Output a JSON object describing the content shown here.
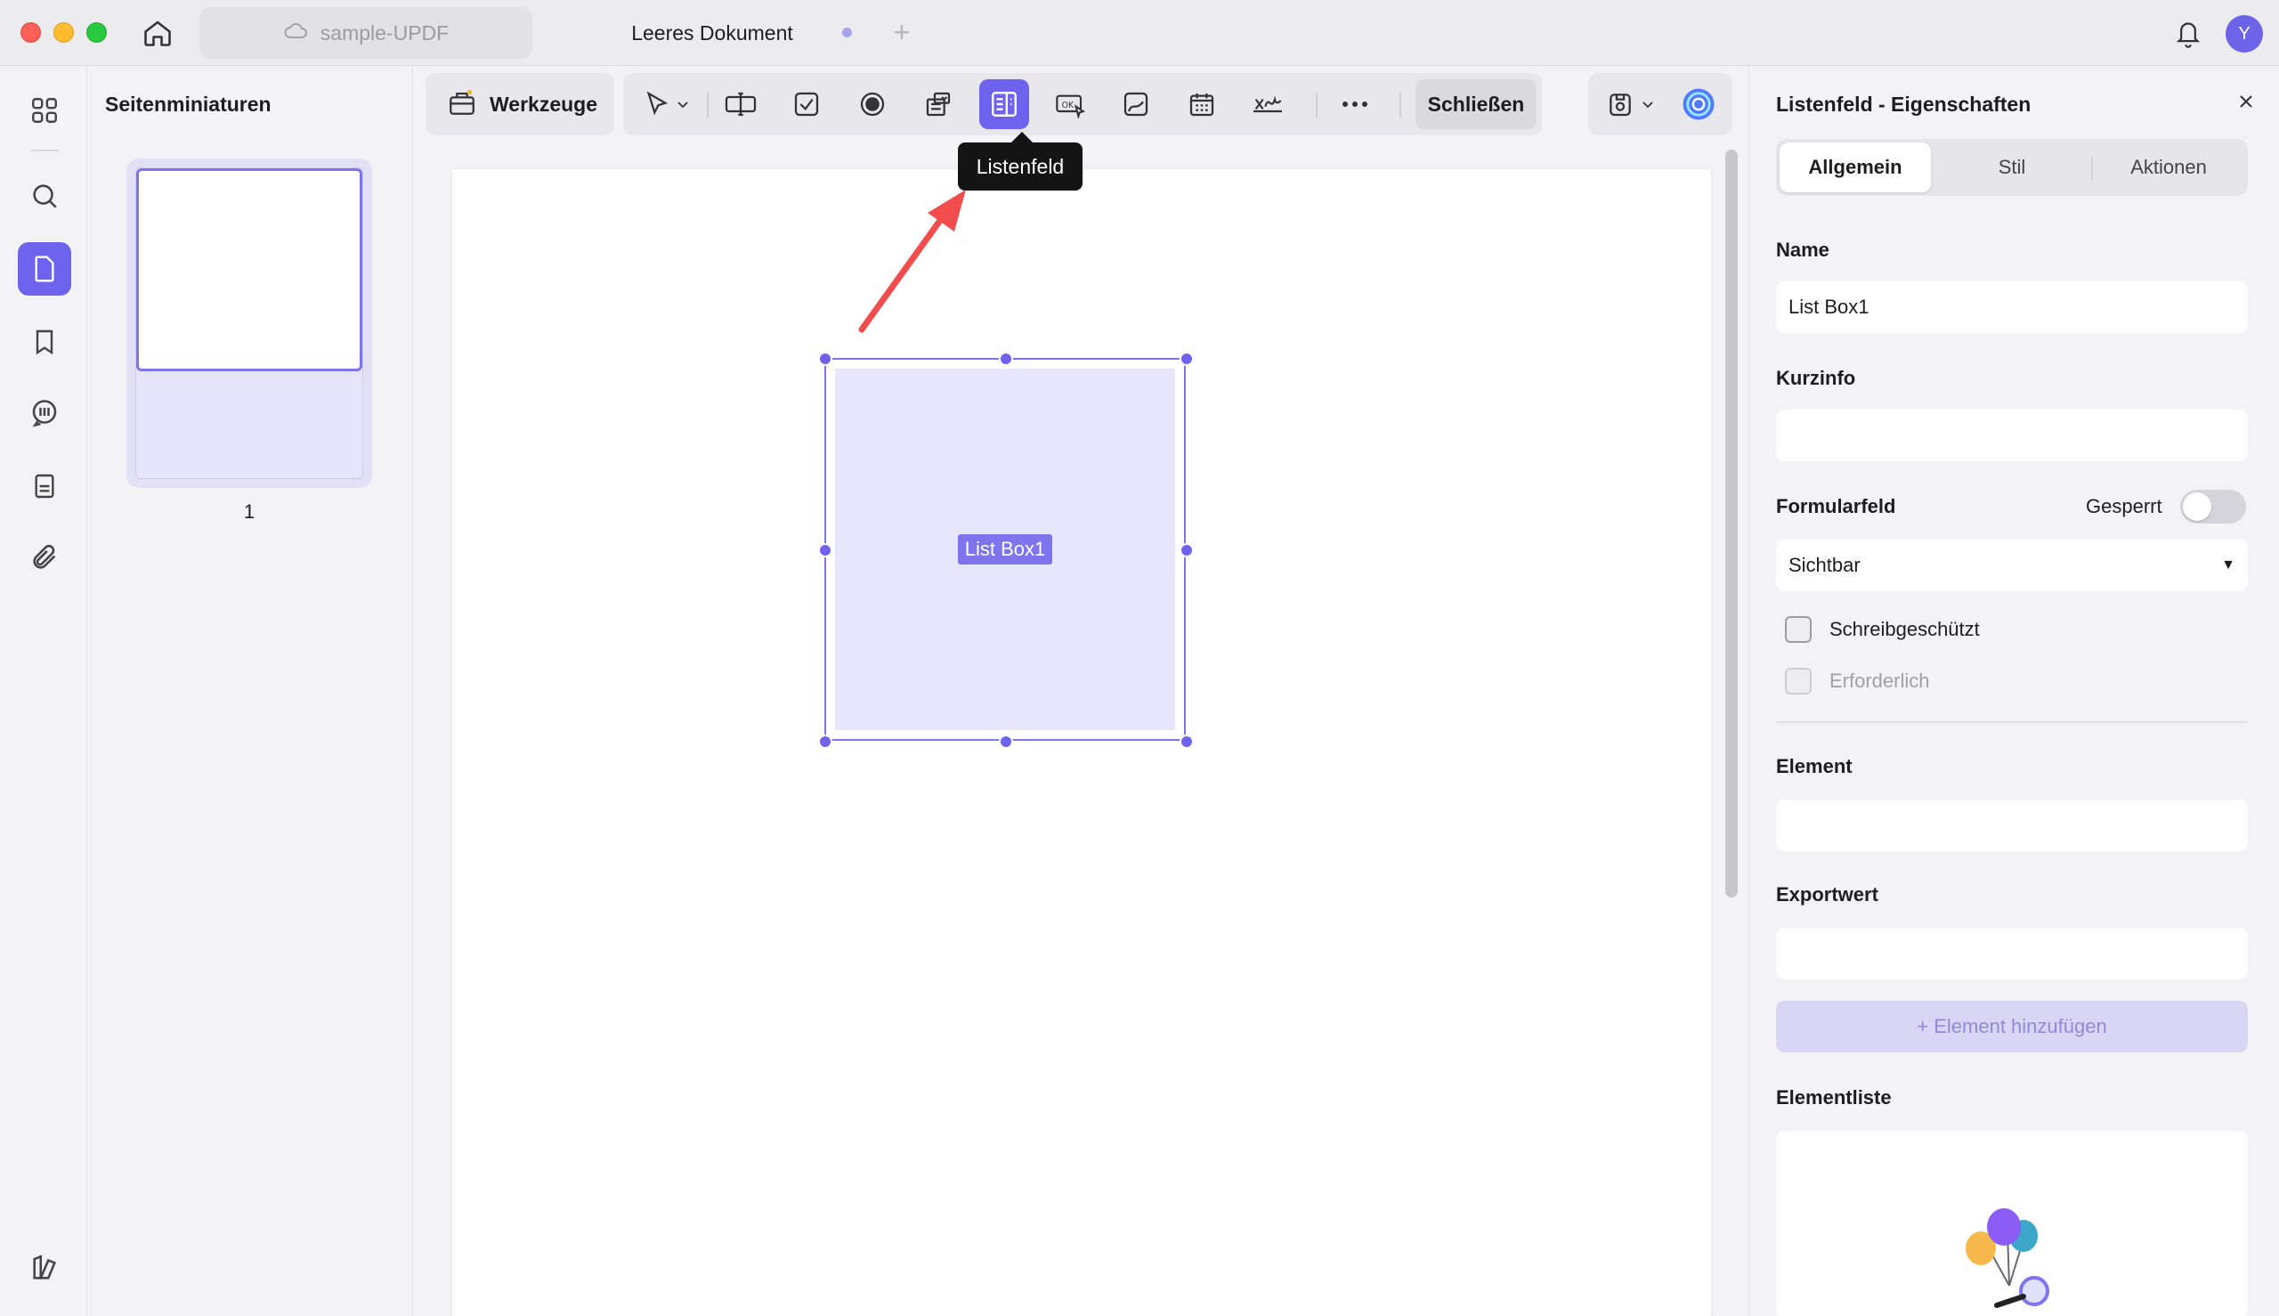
{
  "titlebar": {
    "tabs": [
      {
        "label": "sample-UPDF"
      },
      {
        "label": "Leeres Dokument"
      }
    ],
    "avatar_initial": "Y"
  },
  "thumbnails": {
    "title": "Seitenminiaturen",
    "page_number": "1"
  },
  "toolbar": {
    "tools_label": "Werkzeuge",
    "close_label": "Schließen",
    "tooltip": "Listenfeld"
  },
  "canvas": {
    "field_label": "List Box1"
  },
  "properties": {
    "title": "Listenfeld - Eigenschaften",
    "tabs": [
      "Allgemein",
      "Stil",
      "Aktionen"
    ],
    "name_label": "Name",
    "name_value": "List Box1",
    "tooltip_label": "Kurzinfo",
    "tooltip_value": "",
    "form_field_label": "Formularfeld",
    "locked_label": "Gesperrt",
    "visibility_value": "Sichtbar",
    "readonly_label": "Schreibgeschützt",
    "required_label": "Erforderlich",
    "element_label": "Element",
    "element_value": "",
    "export_label": "Exportwert",
    "export_value": "",
    "add_element_label": "+ Element hinzufügen",
    "element_list_label": "Elementliste"
  },
  "colors": {
    "accent": "#6d63ee",
    "selection": "#7d74ee",
    "field_fill": "#e6e7fb"
  }
}
